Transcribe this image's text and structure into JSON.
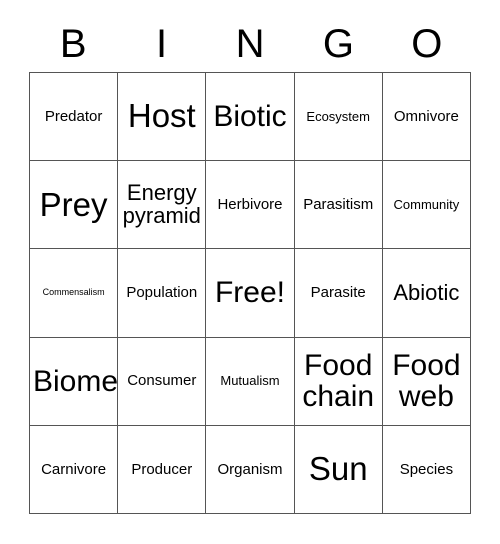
{
  "card": {
    "title": "BINGO Card",
    "background_color": "#ffffff",
    "text_color": "#000000",
    "border_color": "#555555"
  },
  "header": {
    "letters": [
      "B",
      "I",
      "N",
      "G",
      "O"
    ]
  },
  "grid": {
    "rows": 5,
    "columns": 5,
    "free_space": "Free!",
    "cells": [
      {
        "text": "Predator",
        "size": "s-md"
      },
      {
        "text": "Host",
        "size": "s-xxl"
      },
      {
        "text": "Biotic",
        "size": "s-xl"
      },
      {
        "text": "Ecosystem",
        "size": "s-sm"
      },
      {
        "text": "Omnivore",
        "size": "s-md"
      },
      {
        "text": "Prey",
        "size": "s-xxl"
      },
      {
        "text": "Energy\npyramid",
        "size": "s-lg"
      },
      {
        "text": "Herbivore",
        "size": "s-md"
      },
      {
        "text": "Parasitism",
        "size": "s-md"
      },
      {
        "text": "Community",
        "size": "s-sm"
      },
      {
        "text": "Commensalism",
        "size": "s-xs"
      },
      {
        "text": "Population",
        "size": "s-md"
      },
      {
        "text": "Free!",
        "size": "s-xl"
      },
      {
        "text": "Parasite",
        "size": "s-md"
      },
      {
        "text": "Abiotic",
        "size": "s-lg"
      },
      {
        "text": "Biome",
        "size": "s-xl"
      },
      {
        "text": "Consumer",
        "size": "s-md"
      },
      {
        "text": "Mutualism",
        "size": "s-sm"
      },
      {
        "text": "Food\nchain",
        "size": "s-xl"
      },
      {
        "text": "Food\nweb",
        "size": "s-xl"
      },
      {
        "text": "Carnivore",
        "size": "s-md"
      },
      {
        "text": "Producer",
        "size": "s-md"
      },
      {
        "text": "Organism",
        "size": "s-md"
      },
      {
        "text": "Sun",
        "size": "s-xxl"
      },
      {
        "text": "Species",
        "size": "s-md"
      }
    ]
  }
}
